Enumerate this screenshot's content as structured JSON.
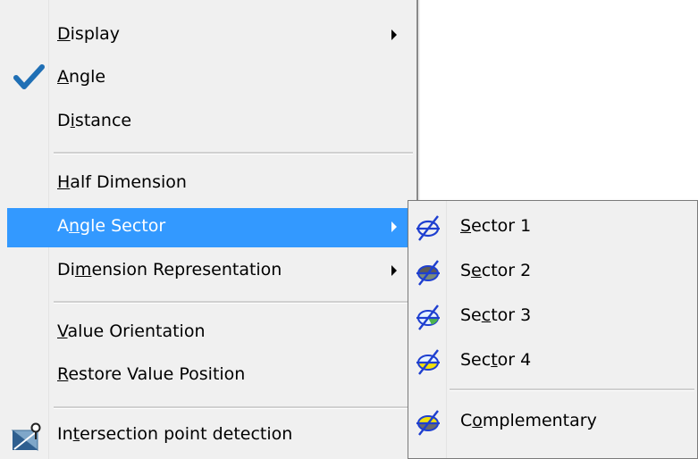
{
  "menu": {
    "items": [
      {
        "pre": "",
        "key": "D",
        "post": "isplay",
        "has_submenu": true
      },
      {
        "pre": "",
        "key": "A",
        "post": "ngle",
        "checked": true
      },
      {
        "pre": "D",
        "key": "i",
        "post": "stance"
      },
      {
        "pre": "",
        "key": "H",
        "post": "alf Dimension"
      },
      {
        "pre": "A",
        "key": "n",
        "post": "gle Sector",
        "has_submenu": true,
        "highlighted": true
      },
      {
        "pre": "Di",
        "key": "m",
        "post": "ension Representation",
        "has_submenu": true
      },
      {
        "pre": "",
        "key": "V",
        "post": "alue Orientation"
      },
      {
        "pre": "",
        "key": "R",
        "post": "estore Value Position"
      },
      {
        "pre": "In",
        "key": "t",
        "post": "ersection point detection",
        "icon": "intersection-point-icon"
      }
    ]
  },
  "submenu": {
    "items": [
      {
        "pre": "",
        "key": "S",
        "post": "ector 1",
        "icon": "sector-1-icon"
      },
      {
        "pre": "S",
        "key": "e",
        "post": "ctor 2",
        "icon": "sector-2-icon"
      },
      {
        "pre": "Se",
        "key": "c",
        "post": "tor 3",
        "icon": "sector-3-icon"
      },
      {
        "pre": "Sec",
        "key": "t",
        "post": "or 4",
        "icon": "sector-4-icon"
      },
      {
        "pre": "C",
        "key": "o",
        "post": "mplementary",
        "icon": "complementary-icon"
      }
    ]
  },
  "colors": {
    "highlight": "#3399ff",
    "menu_bg": "#f0f0f0",
    "check": "#1f6fb5"
  }
}
